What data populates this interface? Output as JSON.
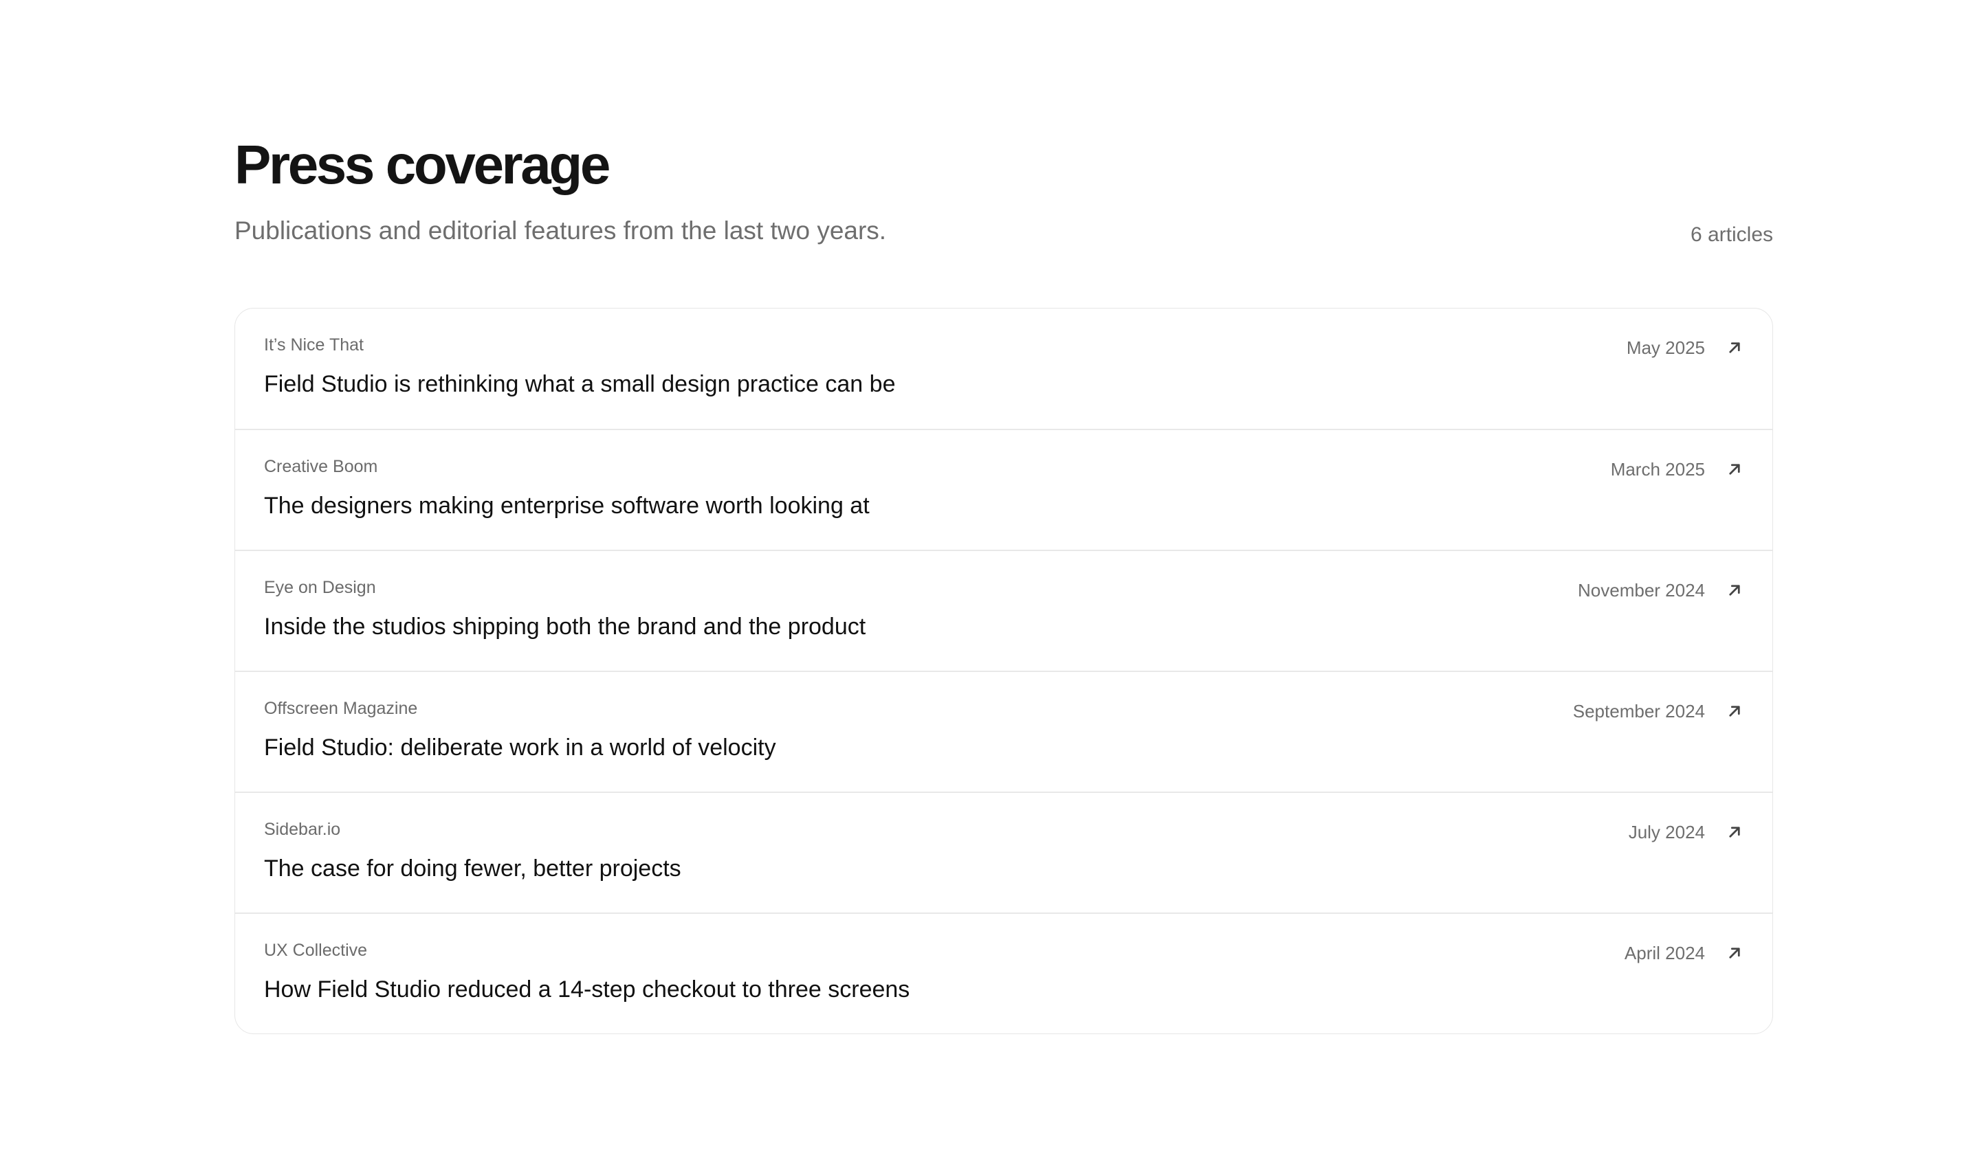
{
  "header": {
    "title": "Press coverage",
    "subtitle": "Publications and editorial features from the last two years.",
    "count": "6 articles"
  },
  "articles": [
    {
      "publication": "It’s Nice That",
      "headline": "Field Studio is rethinking what a small design practice can be",
      "date": "May 2025",
      "icon": "arrow-up-right-icon"
    },
    {
      "publication": "Creative Boom",
      "headline": "The designers making enterprise software worth looking at",
      "date": "March 2025",
      "icon": "arrow-up-right-icon"
    },
    {
      "publication": "Eye on Design",
      "headline": "Inside the studios shipping both the brand and the product",
      "date": "November 2024",
      "icon": "arrow-up-right-icon"
    },
    {
      "publication": "Offscreen Magazine",
      "headline": "Field Studio: deliberate work in a world of velocity",
      "date": "September 2024",
      "icon": "arrow-up-right-icon"
    },
    {
      "publication": "Sidebar.io",
      "headline": "The case for doing fewer, better projects",
      "date": "July 2024",
      "icon": "arrow-up-right-icon"
    },
    {
      "publication": "UX Collective",
      "headline": "How Field Studio reduced a 14-step checkout to three screens",
      "date": "April 2024",
      "icon": "arrow-up-right-icon"
    }
  ],
  "colors": {
    "background": "#ffffff",
    "title": "#141414",
    "muted_text": "#6e6e6e",
    "headline": "#111111",
    "border": "#e6e6e6"
  }
}
